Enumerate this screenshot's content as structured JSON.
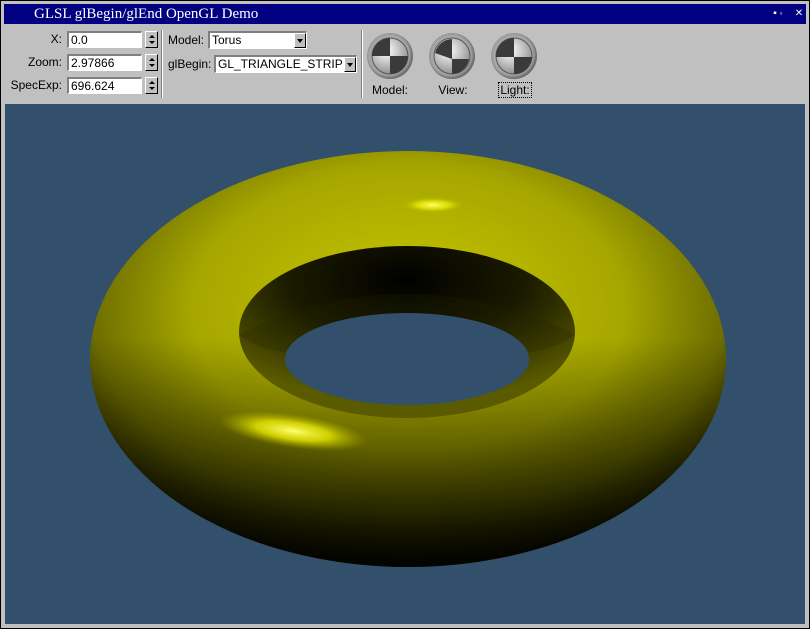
{
  "window": {
    "title": "GLSL glBegin/glEnd OpenGL Demo",
    "minimize_glyph": "▪",
    "maximize_glyph": "▫",
    "close_glyph": "✕"
  },
  "controls": {
    "x": {
      "label": "X:",
      "value": "0.0"
    },
    "zoom": {
      "label": "Zoom:",
      "value": "2.97866"
    },
    "specexp": {
      "label": "SpecExp:",
      "value": "696.624"
    },
    "model": {
      "label": "Model:",
      "value": "Torus"
    },
    "glbegin": {
      "label": "glBegin:",
      "value": "GL_TRIANGLE_STRIP"
    }
  },
  "trackballs": {
    "model": {
      "label": "Model:"
    },
    "view": {
      "label": "View:"
    },
    "light": {
      "label": "Light:"
    }
  },
  "colors": {
    "viewport_bg": "#324f6c",
    "torus": "#b4b400",
    "titlebar": "#000080"
  }
}
